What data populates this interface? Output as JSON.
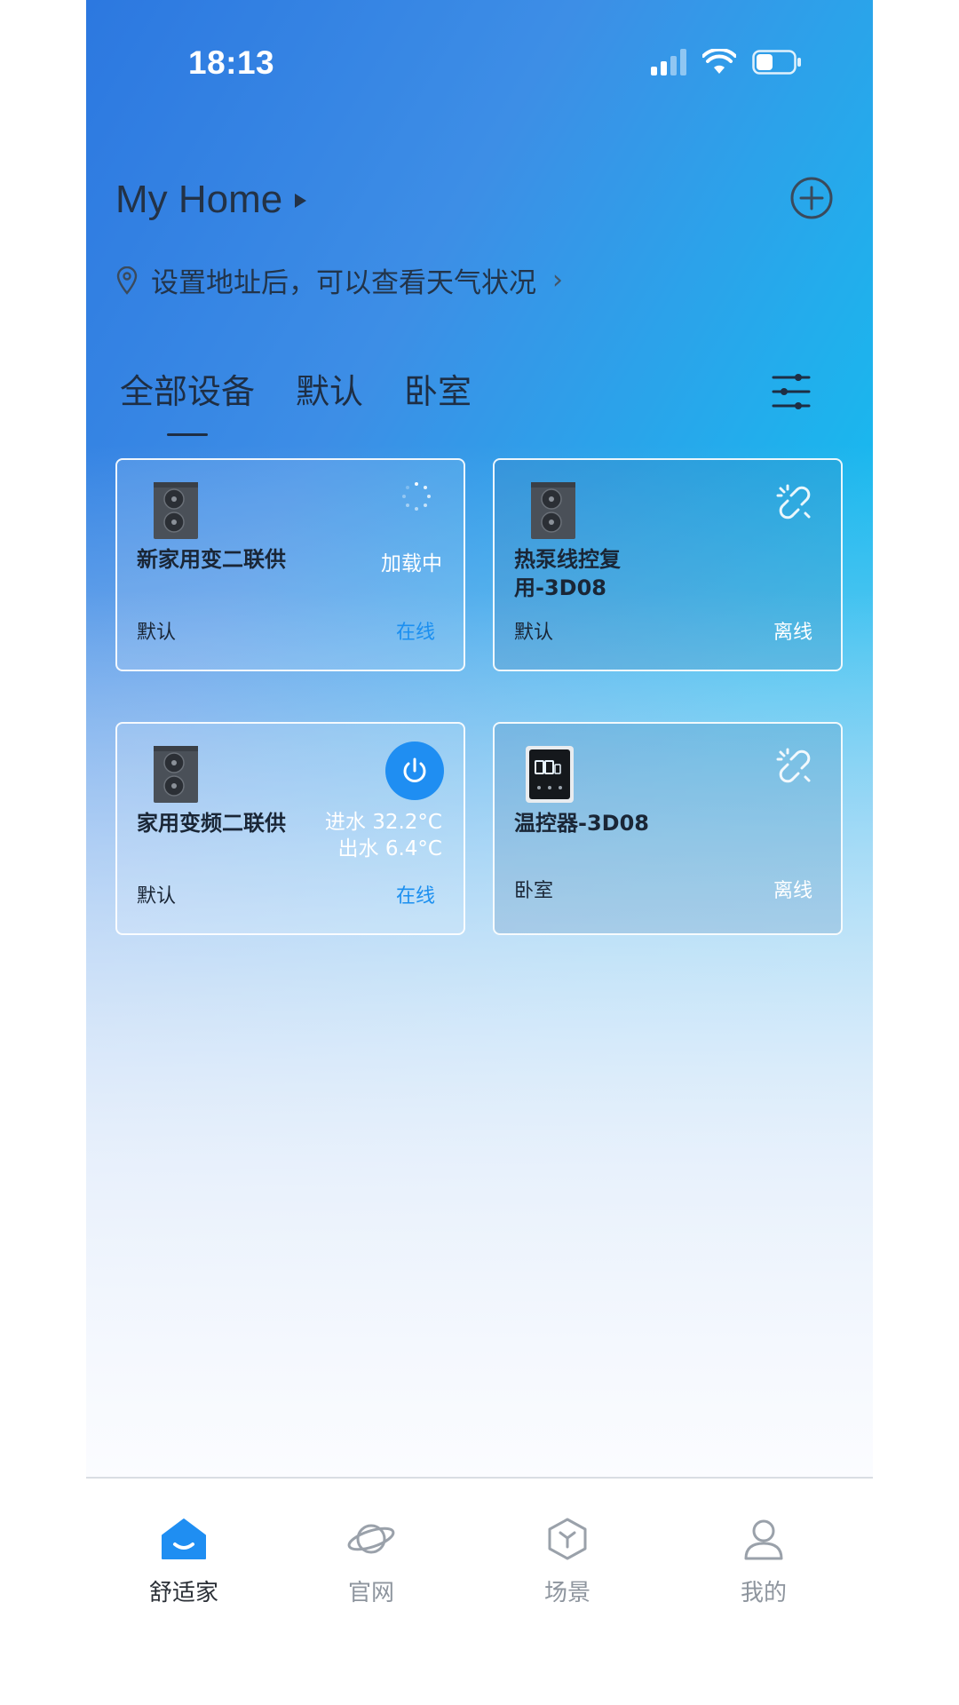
{
  "status_bar": {
    "time": "18:13"
  },
  "header": {
    "home_title": "My Home",
    "address_prompt": "设置地址后，可以查看天气状况"
  },
  "tabs": [
    {
      "label": "全部设备",
      "active": true
    },
    {
      "label": "默认",
      "active": false
    },
    {
      "label": "卧室",
      "active": false
    }
  ],
  "devices": [
    {
      "name": "新家用变二联供",
      "room": "默认",
      "status": "在线",
      "detail": "加载中"
    },
    {
      "name": "热泵线控复用-3D08",
      "room": "默认",
      "status": "离线"
    },
    {
      "name": "家用变频二联供",
      "room": "默认",
      "status": "在线",
      "inlet": "进水 32.2°C",
      "outlet": "出水 6.4°C"
    },
    {
      "name": "温控器-3D08",
      "room": "卧室",
      "status": "离线"
    }
  ],
  "tabbar": [
    {
      "label": "舒适家",
      "icon": "home-icon",
      "active": true
    },
    {
      "label": "官网",
      "icon": "planet-icon",
      "active": false
    },
    {
      "label": "场景",
      "icon": "cube-icon",
      "active": false
    },
    {
      "label": "我的",
      "icon": "user-icon",
      "active": false
    }
  ],
  "colors": {
    "accent": "#1f8ef2",
    "online": "#1b8ff0",
    "text_dark": "#1a2636"
  }
}
